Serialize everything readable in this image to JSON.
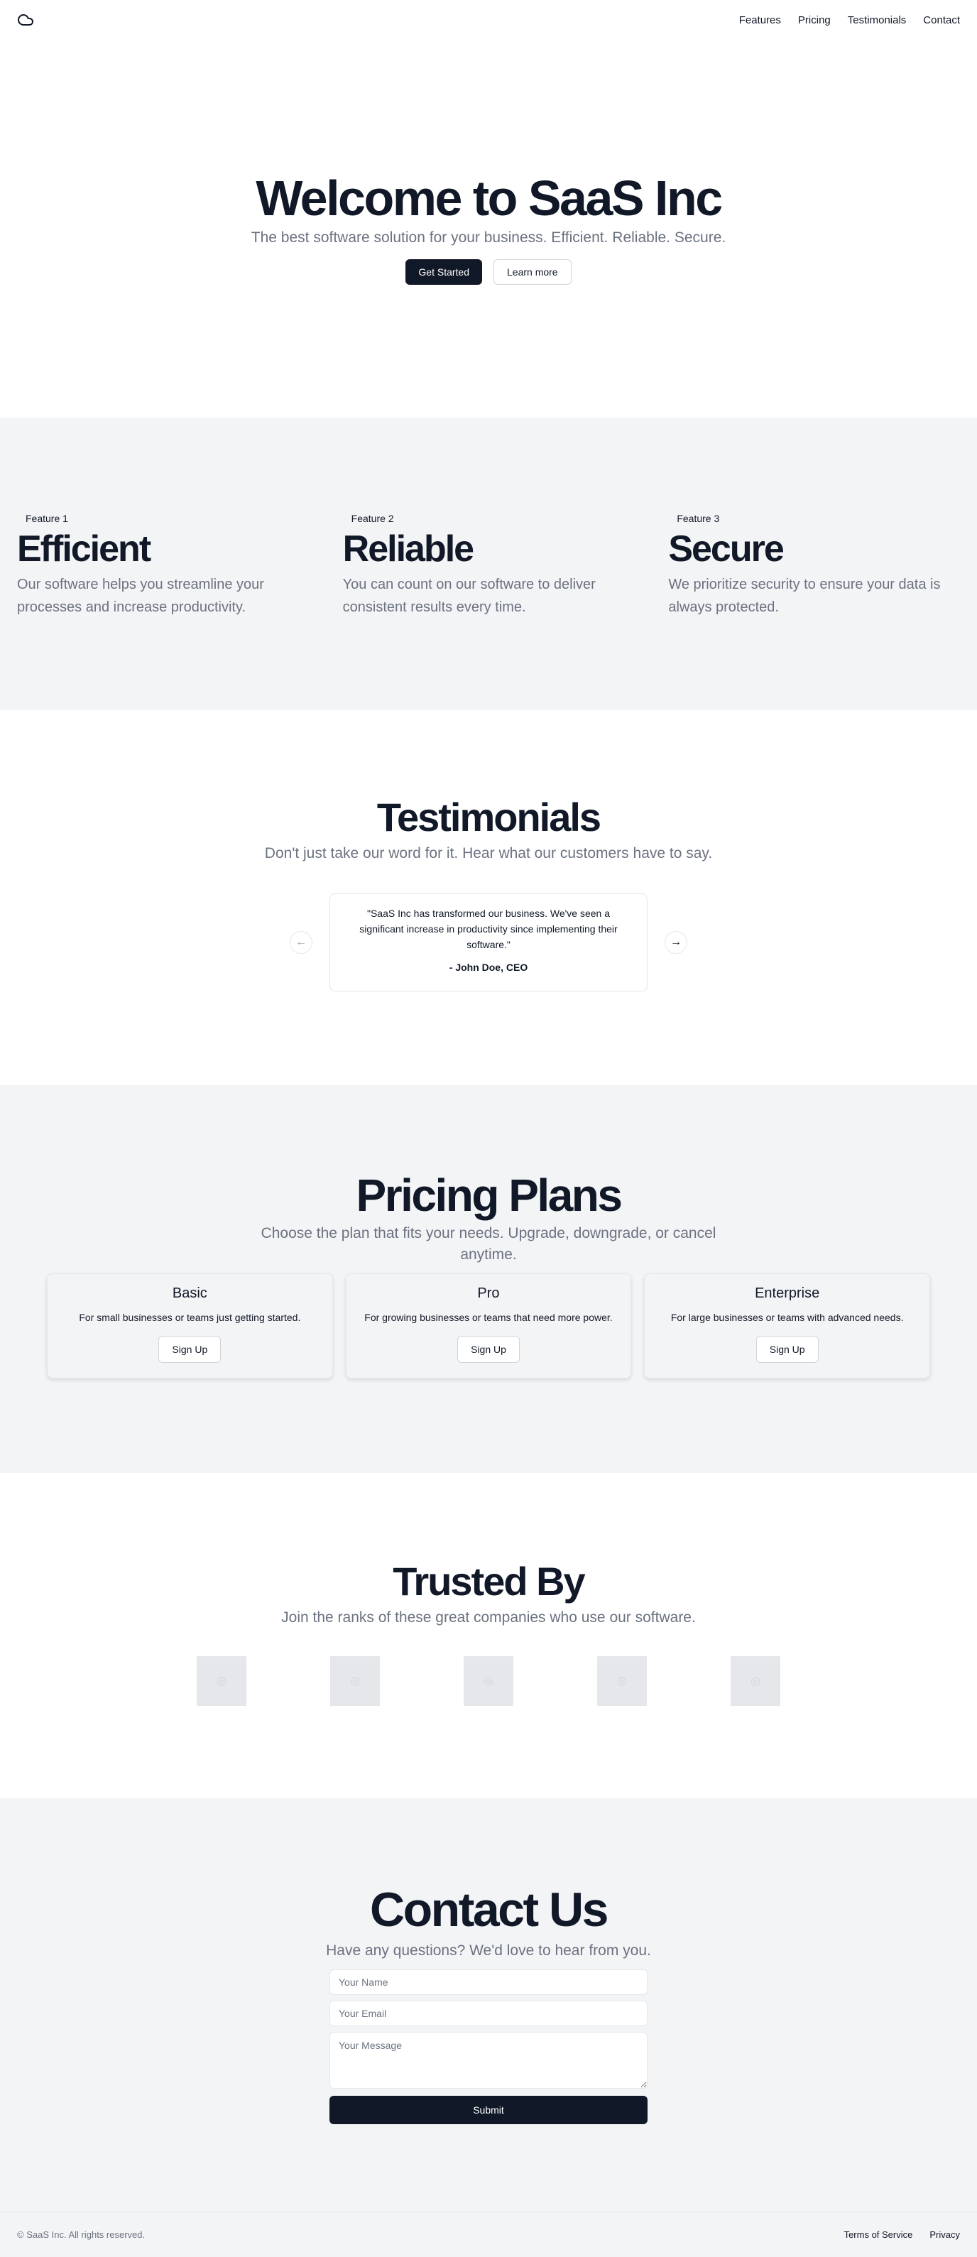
{
  "header": {
    "logo_icon": "cloud-icon",
    "nav": [
      "Features",
      "Pricing",
      "Testimonials",
      "Contact"
    ]
  },
  "hero": {
    "title": "Welcome to SaaS Inc",
    "subtitle": "The best software solution for your business. Efficient. Reliable. Secure.",
    "primary_cta": "Get Started",
    "secondary_cta": "Learn more"
  },
  "features": [
    {
      "badge": "Feature 1",
      "title": "Efficient",
      "desc": "Our software helps you streamline your processes and increase productivity."
    },
    {
      "badge": "Feature 2",
      "title": "Reliable",
      "desc": "You can count on our software to deliver consistent results every time."
    },
    {
      "badge": "Feature 3",
      "title": "Secure",
      "desc": "We prioritize security to ensure your data is always protected."
    }
  ],
  "testimonials": {
    "title": "Testimonials",
    "subtitle": "Don't just take our word for it. Hear what our customers have to say.",
    "quote": "\"SaaS Inc has transformed our business. We've seen a significant increase in productivity since implementing their software.\"",
    "author": "- John Doe, CEO"
  },
  "pricing": {
    "title": "Pricing Plans",
    "subtitle": "Choose the plan that fits your needs. Upgrade, downgrade, or cancel anytime.",
    "plans": [
      {
        "name": "Basic",
        "desc": "For small businesses or teams just getting started.",
        "cta": "Sign Up"
      },
      {
        "name": "Pro",
        "desc": "For growing businesses or teams that need more power.",
        "cta": "Sign Up"
      },
      {
        "name": "Enterprise",
        "desc": "For large businesses or teams with advanced needs.",
        "cta": "Sign Up"
      }
    ]
  },
  "trusted": {
    "title": "Trusted By",
    "subtitle": "Join the ranks of these great companies who use our software."
  },
  "contact": {
    "title": "Contact Us",
    "subtitle": "Have any questions? We'd love to hear from you.",
    "name_placeholder": "Your Name",
    "email_placeholder": "Your Email",
    "message_placeholder": "Your Message",
    "submit": "Submit"
  },
  "footer": {
    "copyright": "© SaaS Inc. All rights reserved.",
    "links": [
      "Terms of Service",
      "Privacy"
    ]
  }
}
